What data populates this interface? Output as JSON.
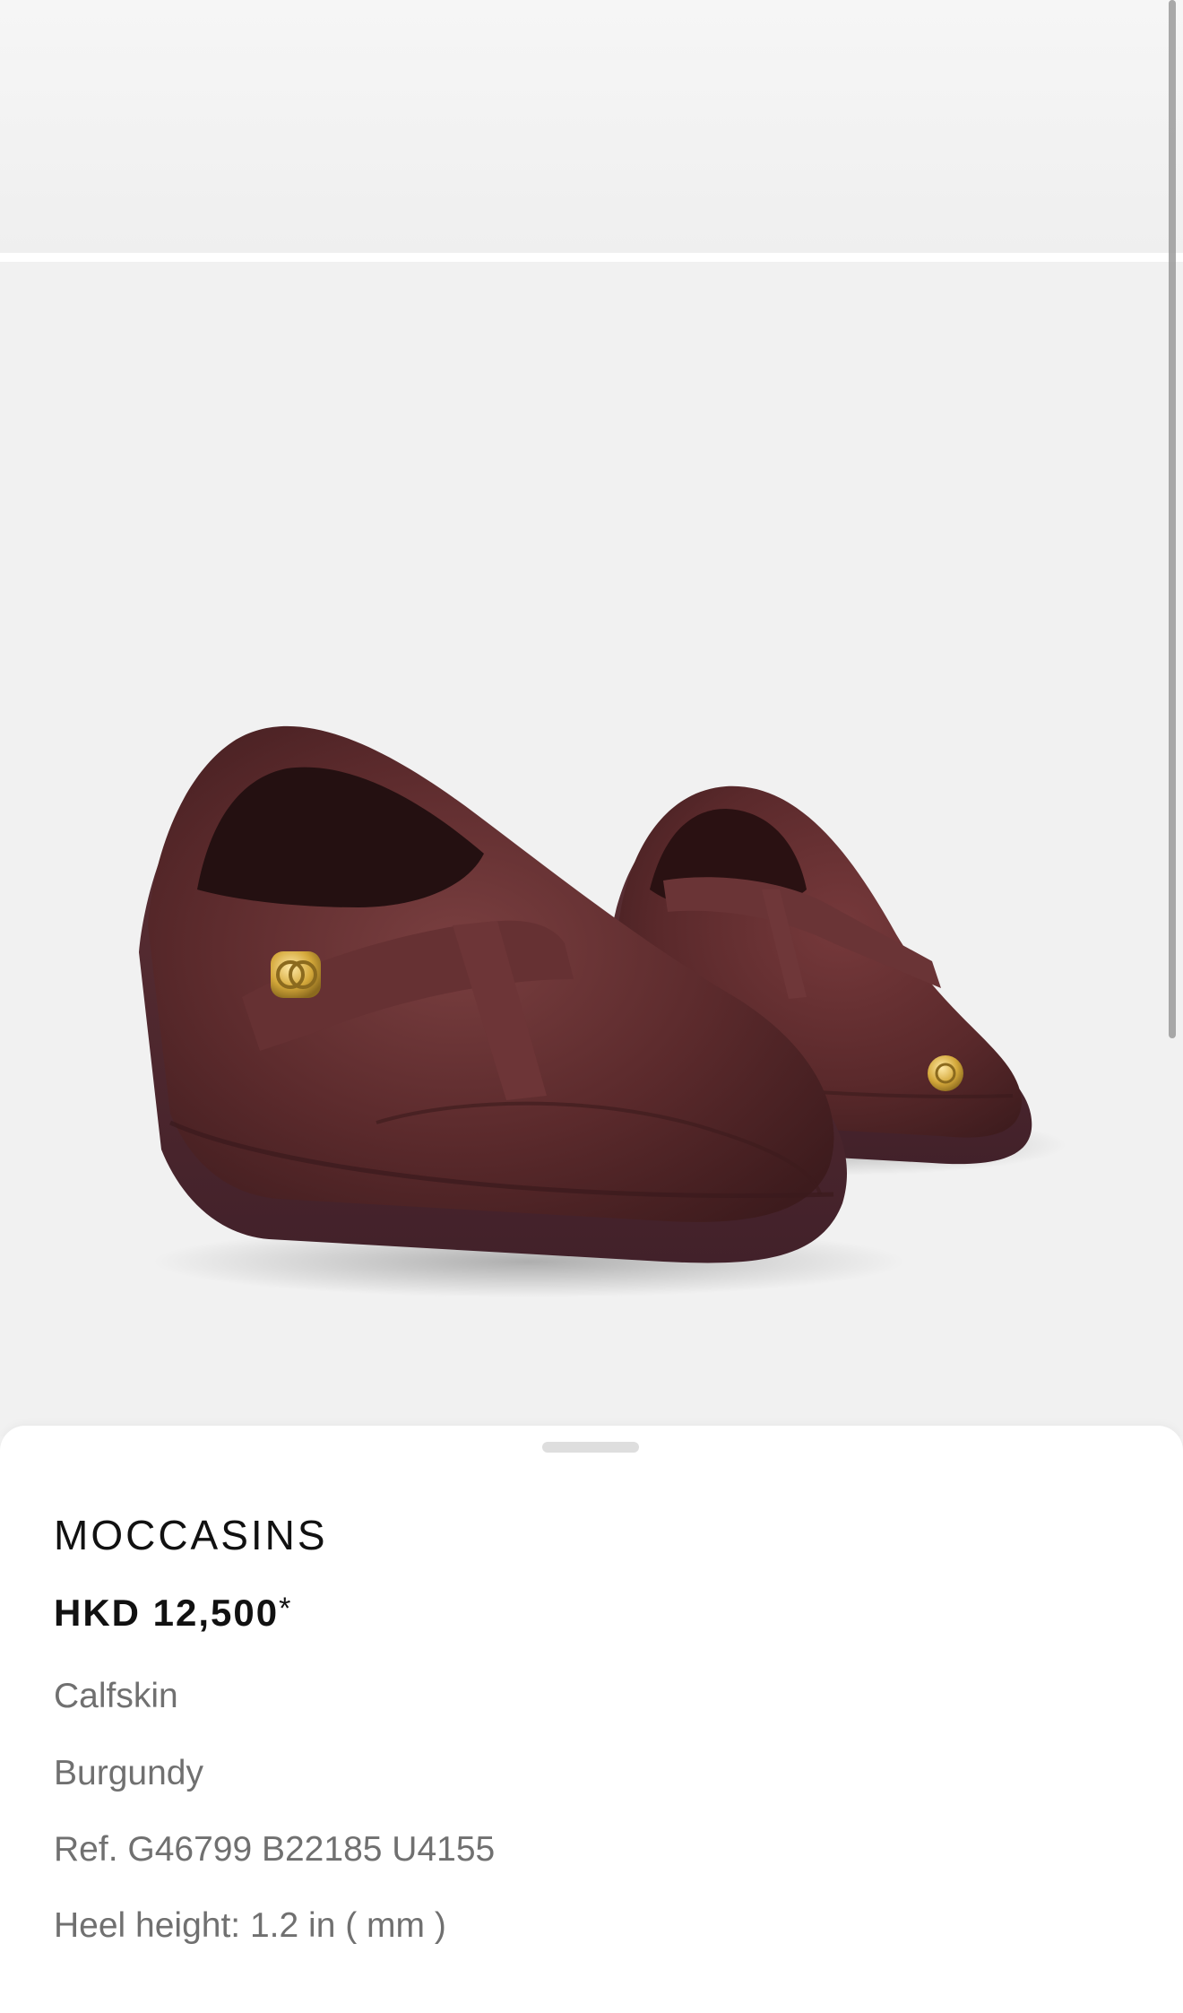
{
  "product": {
    "name": "MOCCASINS",
    "price": "HKD 12,500",
    "price_mark": "*",
    "material": "Calfskin",
    "color": "Burgundy",
    "reference": "Ref. G46799 B22185 U4155",
    "heel_height": "Heel height: 1.2 in ( mm )"
  },
  "colors": {
    "shoe": "#5b2a2c",
    "background": "#f2f2f2",
    "hardware": "#d4a83a"
  },
  "icons": {
    "sheet_handle": "drag-handle-icon"
  }
}
